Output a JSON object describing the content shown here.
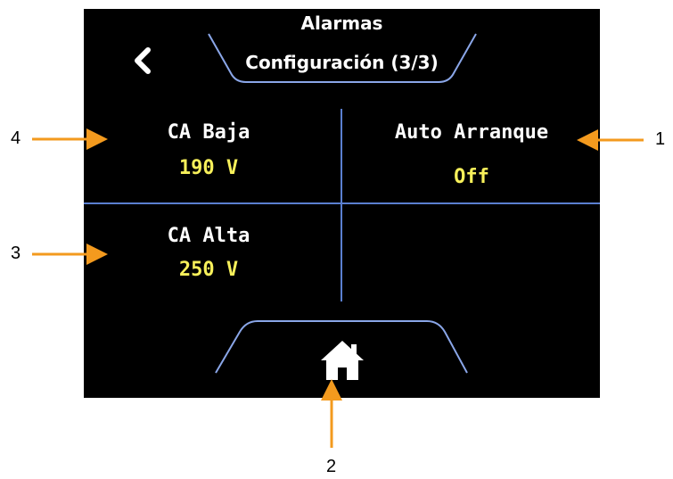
{
  "header": {
    "title": "Alarmas",
    "subtitle": "Configuración (3/3)"
  },
  "cells": {
    "ca_baja": {
      "label": "CA Baja",
      "value": "190 V"
    },
    "auto_arranque": {
      "label": "Auto Arranque",
      "value": "Off"
    },
    "ca_alta": {
      "label": "CA Alta",
      "value": "250 V"
    }
  },
  "icons": {
    "back": "chevron-left-icon",
    "home": "home-icon"
  },
  "callouts": {
    "one": "1",
    "two": "2",
    "three": "3",
    "four": "4"
  },
  "colors": {
    "screen": "#000000",
    "label": "#ffffff",
    "value": "#f7f05a",
    "divider": "#5a7fd0",
    "arrow": "#f39a1e"
  }
}
